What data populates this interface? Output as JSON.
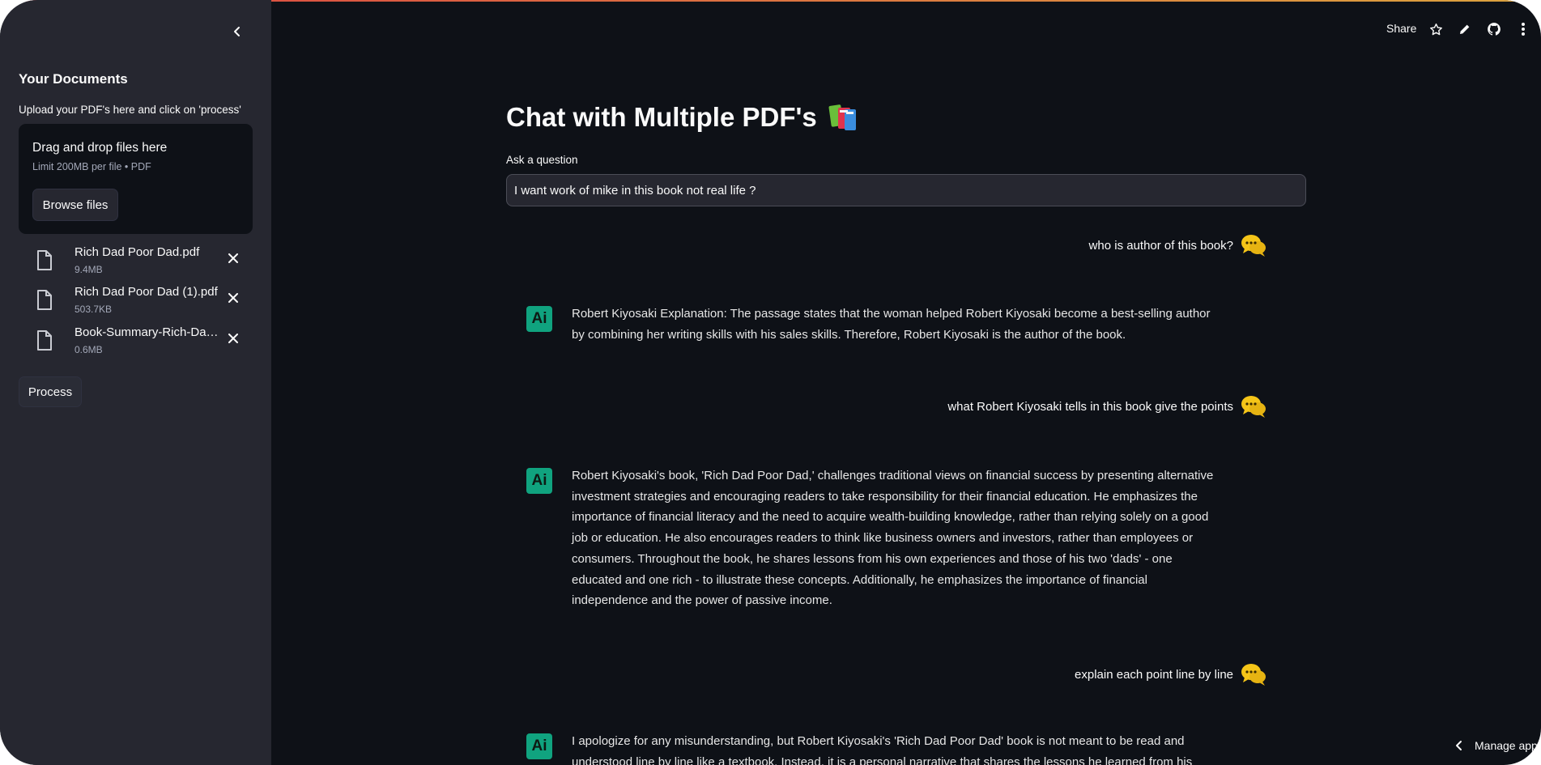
{
  "sidebar": {
    "heading": "Your Documents",
    "caption": "Upload your PDF's here and click on 'process'",
    "dropzone": {
      "title": "Drag and drop files here",
      "limit": "Limit 200MB per file • PDF",
      "browse_label": "Browse files"
    },
    "files": [
      {
        "name": "Rich Dad Poor Dad.pdf",
        "size": "9.4MB"
      },
      {
        "name": "Rich Dad Poor Dad (1).pdf",
        "size": "503.7KB"
      },
      {
        "name": "Book-Summary-Rich-Dad-Poor-Dad.pdf",
        "size": "0.6MB"
      }
    ],
    "process_label": "Process"
  },
  "toolbar": {
    "share_label": "Share",
    "icons": [
      "star-icon",
      "pencil-icon",
      "github-icon",
      "more-vertical-icon"
    ]
  },
  "main": {
    "title": "Chat with Multiple PDF's",
    "title_emoji": "books-icon",
    "question_label": "Ask a question",
    "question_value": "I want work of mike in this book not real life ?"
  },
  "chat": [
    {
      "role": "user",
      "text": "who is author of this book?"
    },
    {
      "role": "bot",
      "avatar": "Ai",
      "text": "Robert Kiyosaki Explanation: The passage states that the woman helped Robert Kiyosaki become a best-selling author by combining her writing skills with his sales skills. Therefore, Robert Kiyosaki is the author of the book."
    },
    {
      "role": "user",
      "text": "what Robert Kiyosaki tells in this book give the points"
    },
    {
      "role": "bot",
      "avatar": "Ai",
      "text": "Robert Kiyosaki's book, 'Rich Dad Poor Dad,' challenges traditional views on financial success by presenting alternative investment strategies and encouraging readers to take responsibility for their financial education. He emphasizes the importance of financial literacy and the need to acquire wealth-building knowledge, rather than relying solely on a good job or education. He also encourages readers to think like business owners and investors, rather than employees or consumers. Throughout the book, he shares lessons from his own experiences and those of his two 'dads' - one educated and one rich - to illustrate these concepts. Additionally, he emphasizes the importance of financial independence and the power of passive income."
    },
    {
      "role": "user",
      "text": "explain each point line by line"
    },
    {
      "role": "bot",
      "avatar": "Ai",
      "text": "I apologize for any misunderstanding, but Robert Kiyosaki's 'Rich Dad Poor Dad' book is not meant to be read and understood line by line like a textbook. Instead, it is a personal narrative that shares the lessons he learned from his"
    }
  ],
  "footer": {
    "manage_label": "Manage app"
  },
  "colors": {
    "background": "#0e1117",
    "sidebar": "#262730",
    "bot_avatar": "#10a37f",
    "user_avatar": "#f5c518"
  }
}
